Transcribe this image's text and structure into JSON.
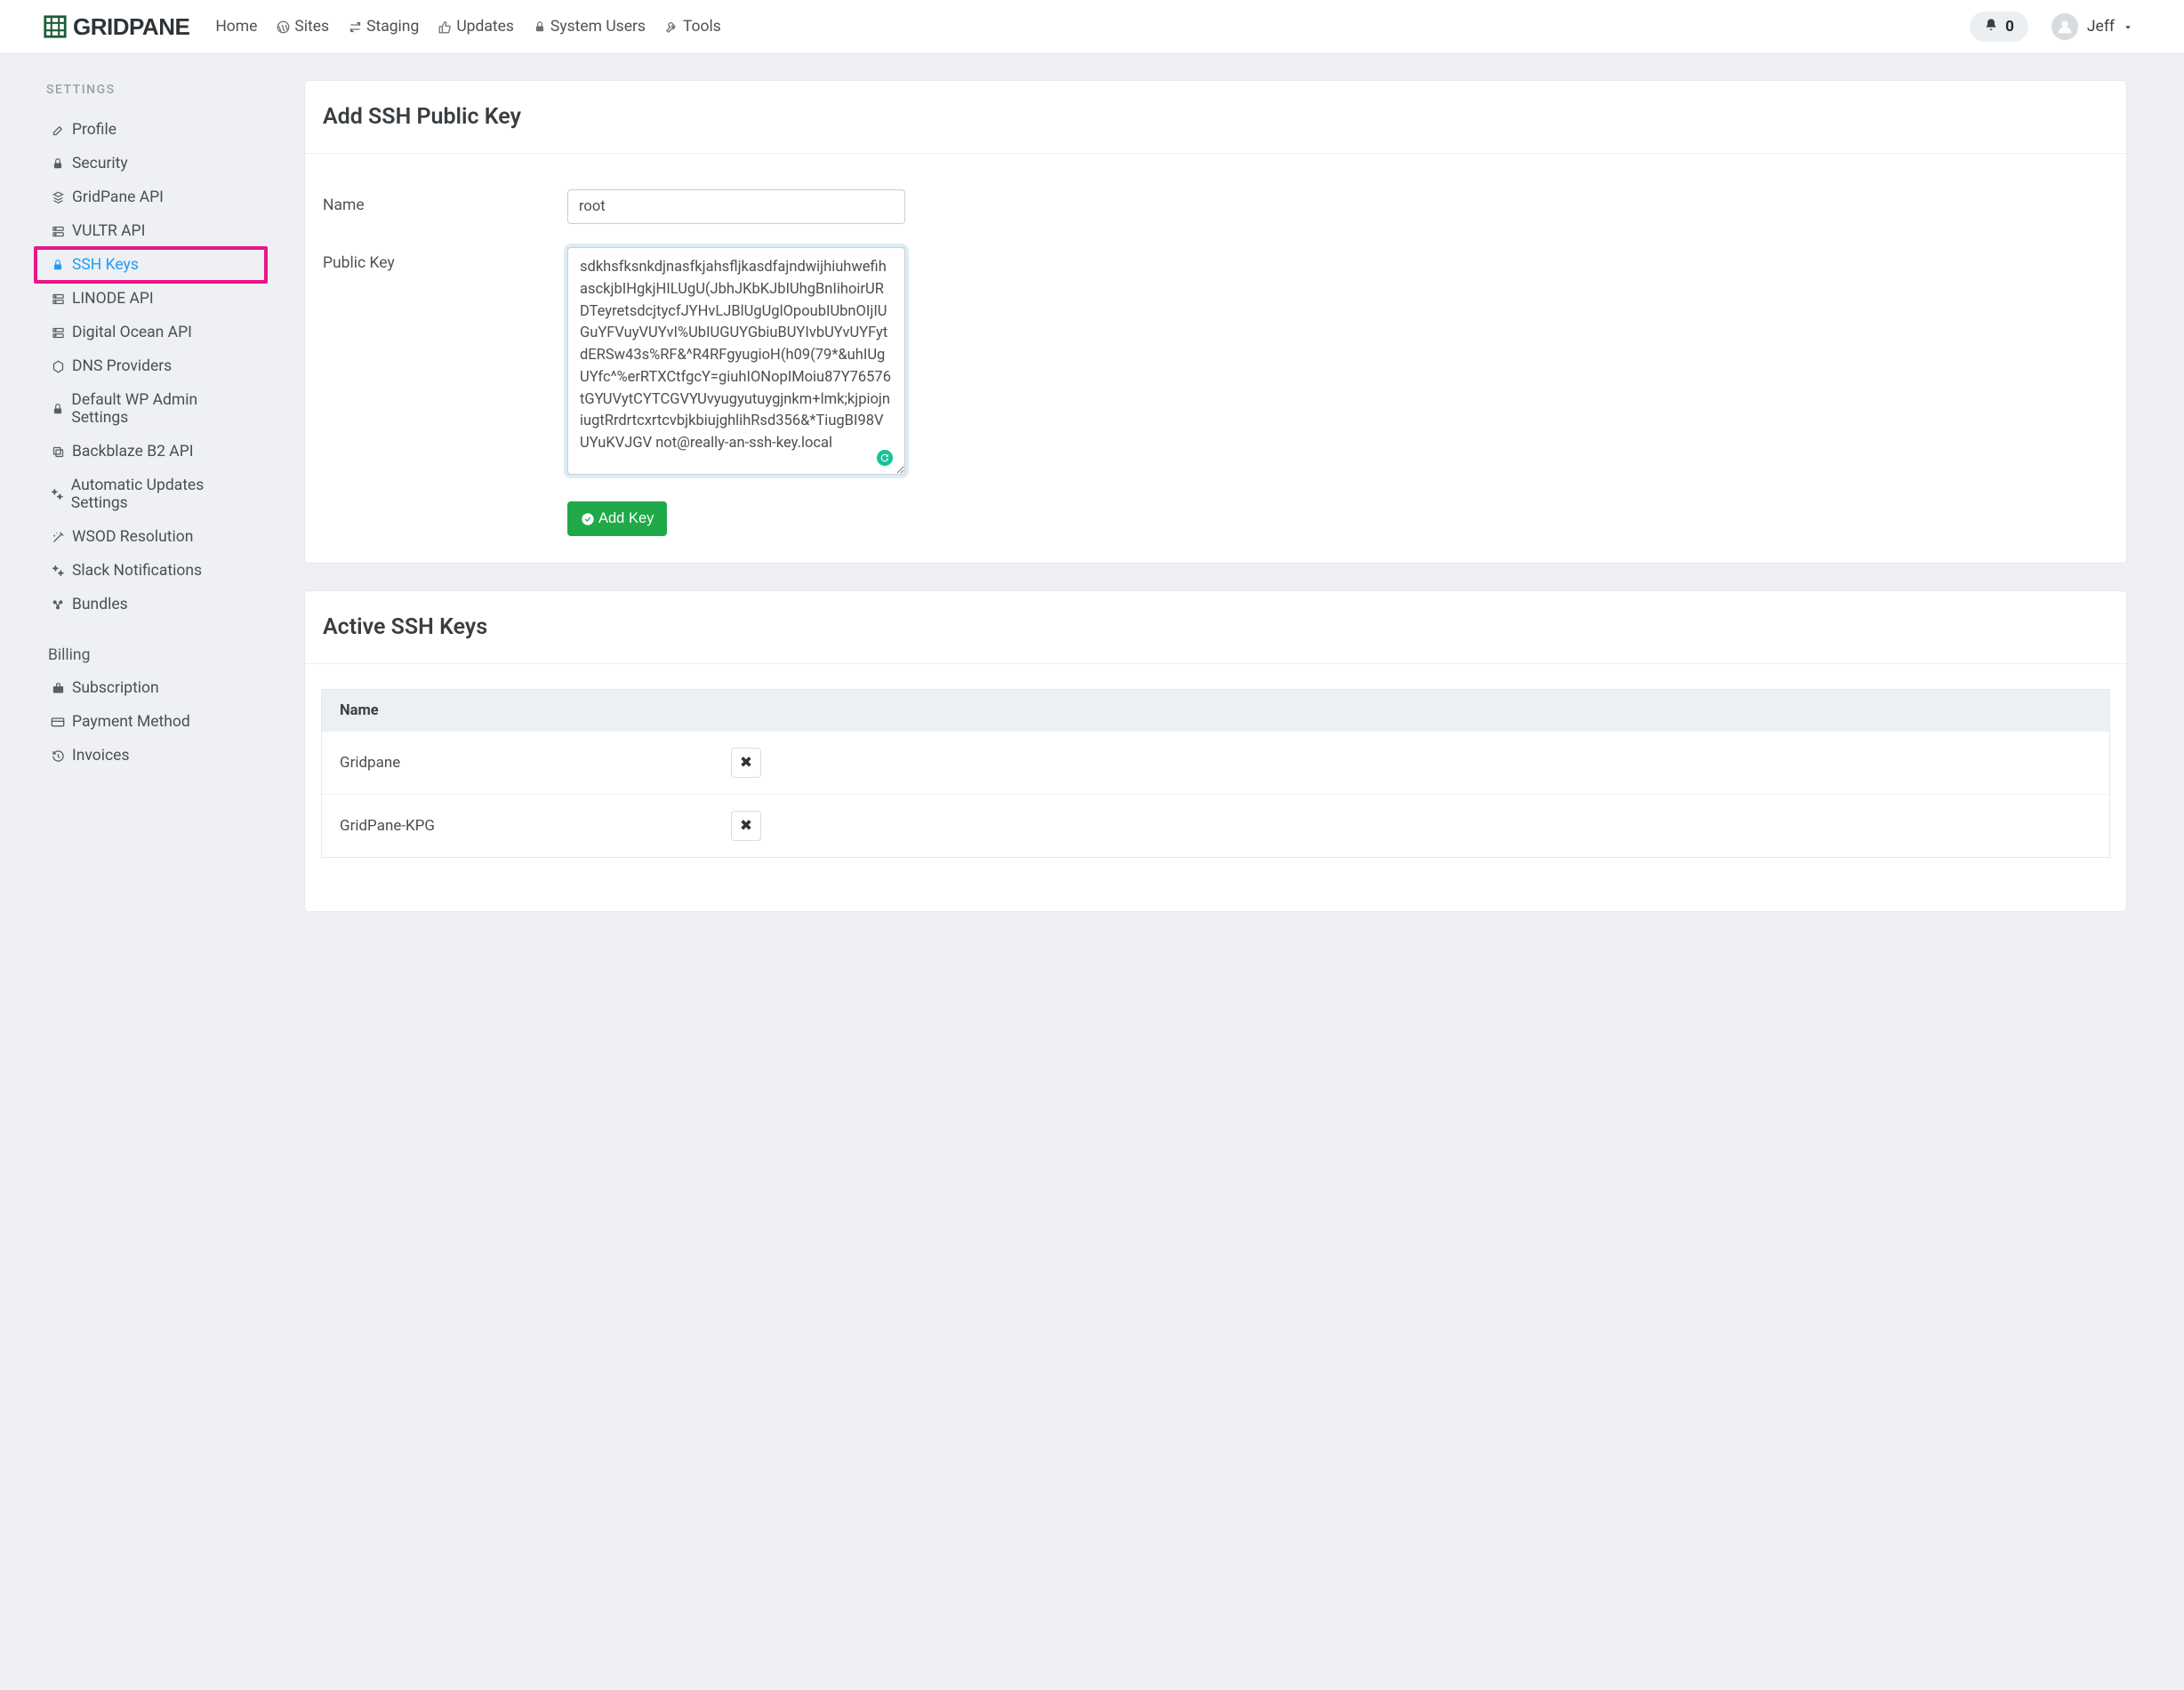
{
  "brand": {
    "text": "GRIDPANE"
  },
  "nav": {
    "home": "Home",
    "sites": "Sites",
    "staging": "Staging",
    "updates": "Updates",
    "system_users": "System Users",
    "tools": "Tools"
  },
  "notifications": {
    "count": "0"
  },
  "user": {
    "name": "Jeff"
  },
  "sidebar": {
    "title": "SETTINGS",
    "items": [
      {
        "label": "Profile",
        "icon": "edit-icon"
      },
      {
        "label": "Security",
        "icon": "lock-icon"
      },
      {
        "label": "GridPane API",
        "icon": "platform-icon"
      },
      {
        "label": "VULTR API",
        "icon": "server-icon"
      },
      {
        "label": "SSH Keys",
        "icon": "lock-icon",
        "active": true
      },
      {
        "label": "LINODE API",
        "icon": "server-icon"
      },
      {
        "label": "Digital Ocean API",
        "icon": "server-icon"
      },
      {
        "label": "DNS Providers",
        "icon": "hex-icon"
      },
      {
        "label": "Default WP Admin Settings",
        "icon": "lock-icon"
      },
      {
        "label": "Backblaze B2 API",
        "icon": "copy-icon"
      },
      {
        "label": "Automatic Updates Settings",
        "icon": "cogs-icon"
      },
      {
        "label": "WSOD Resolution",
        "icon": "wand-icon"
      },
      {
        "label": "Slack Notifications",
        "icon": "cogs-icon"
      },
      {
        "label": "Bundles",
        "icon": "bundle-icon"
      }
    ],
    "billing_heading": "Billing",
    "billing": [
      {
        "label": "Subscription",
        "icon": "briefcase-icon"
      },
      {
        "label": "Payment Method",
        "icon": "card-icon"
      },
      {
        "label": "Invoices",
        "icon": "history-icon"
      }
    ]
  },
  "add_card": {
    "title": "Add SSH Public Key",
    "name_label": "Name",
    "name_value": "root",
    "pubkey_label": "Public Key",
    "pubkey_value": "sdkhsfksnkdjnasfkjahsfljkasdfajndwijhiuhwefihasckjbIHgkjHILUgU(JbhJKbKJbIUhgBnIihoirURDTeyretsdcjtycfJYHvLJBlUgUglOpoubIUbnOIjIUGuYFVuyVUYvI%UbIUGUYGbiuBUYIvbUYvUYFytdERSw43s%RF&^R4RFgyugioH(h09(79*&uhIUgUYfc^%erRTXCtfgcY=giuhIONopIMoiu87Y76576tGYUVytCYTCGVYUvyugyutuygjnkm+lmk;kjpiojniugtRrdrtcxrtcvbjkbiujghlihRsd356&*TiugBI98VUYuKVJGV not@really-an-ssh-key.local",
    "submit_label": "Add Key"
  },
  "keys_card": {
    "title": "Active SSH Keys",
    "col_name": "Name",
    "rows": [
      {
        "name": "Gridpane"
      },
      {
        "name": "GridPane-KPG"
      }
    ]
  }
}
